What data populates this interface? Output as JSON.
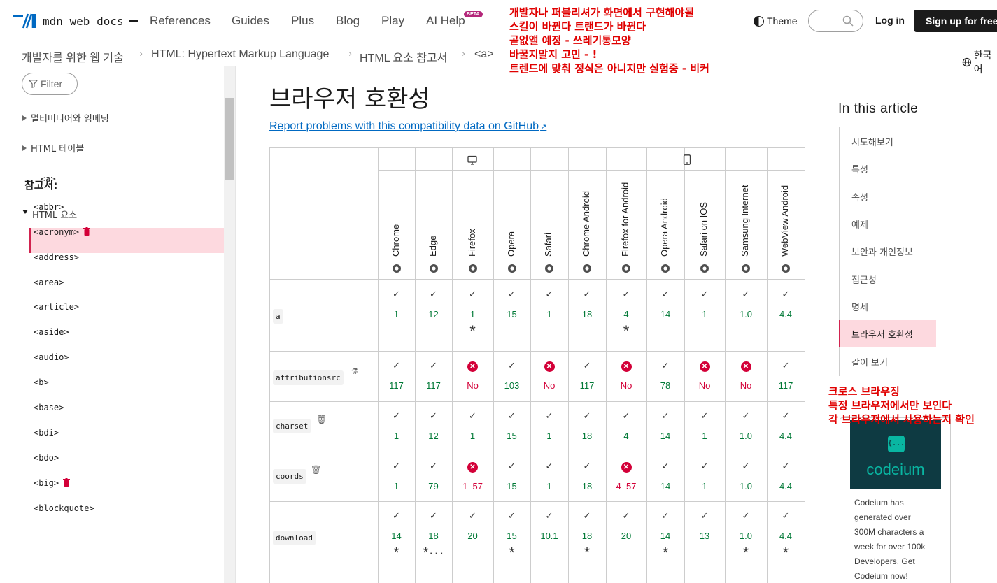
{
  "header": {
    "logo_text": "mdn web docs",
    "nav": [
      "References",
      "Guides",
      "Plus",
      "Blog",
      "Play",
      "AI Help"
    ],
    "ai_badge": "BETA",
    "theme_label": "Theme",
    "login_label": "Log in",
    "signup_label": "Sign up for free"
  },
  "breadcrumb": {
    "items": [
      "개발자를 위한 웹 기술",
      "HTML: Hypertext Markup Language",
      "HTML 요소 참고서",
      "<a>"
    ],
    "language": "한국어"
  },
  "notes": {
    "top": [
      "개발자나 퍼블리셔가 화면에서 구현해야될",
      "스킬이 바뀐다  트랜드가 바뀐다",
      "곧없앨 예정 - 쓰레기통모양",
      "바꿀지말지 고민 - !",
      "트렌드에 맞춰 정식은 아니지만 실험중 - 비커"
    ],
    "right": [
      "크로스 브라우징",
      "특정 브라우저에서만 보인다",
      "각 브라우저에서 사용하는지 확인"
    ]
  },
  "sidebar": {
    "filter_label": "Filter",
    "groups": [
      "멀티미디어와 임베딩",
      "HTML 테이블"
    ],
    "reference_heading": "참고서:",
    "open_group": "HTML 요소",
    "items": [
      {
        "label": "<a>",
        "active": true,
        "deprecated": false
      },
      {
        "label": "<abbr>",
        "active": false,
        "deprecated": false
      },
      {
        "label": "<acronym>",
        "active": false,
        "deprecated": true
      },
      {
        "label": "<address>",
        "active": false,
        "deprecated": false
      },
      {
        "label": "<area>",
        "active": false,
        "deprecated": false
      },
      {
        "label": "<article>",
        "active": false,
        "deprecated": false
      },
      {
        "label": "<aside>",
        "active": false,
        "deprecated": false
      },
      {
        "label": "<audio>",
        "active": false,
        "deprecated": false
      },
      {
        "label": "<b>",
        "active": false,
        "deprecated": false
      },
      {
        "label": "<base>",
        "active": false,
        "deprecated": false
      },
      {
        "label": "<bdi>",
        "active": false,
        "deprecated": false
      },
      {
        "label": "<bdo>",
        "active": false,
        "deprecated": false
      },
      {
        "label": "<big>",
        "active": false,
        "deprecated": true
      },
      {
        "label": "<blockquote>",
        "active": false,
        "deprecated": false
      }
    ]
  },
  "main": {
    "title": "브라우저 호환성",
    "github_link": "Report problems with this compatibility data on GitHub",
    "compat": {
      "browsers": [
        {
          "name": "Chrome",
          "icon": "chrome-icon",
          "platform": "desktop"
        },
        {
          "name": "Edge",
          "icon": "edge-icon",
          "platform": "desktop"
        },
        {
          "name": "Firefox",
          "icon": "firefox-icon",
          "platform": "desktop"
        },
        {
          "name": "Opera",
          "icon": "opera-icon",
          "platform": "desktop"
        },
        {
          "name": "Safari",
          "icon": "safari-icon",
          "platform": "desktop"
        },
        {
          "name": "Chrome Android",
          "icon": "chrome-icon",
          "platform": "mobile"
        },
        {
          "name": "Firefox for Android",
          "icon": "firefox-icon",
          "platform": "mobile"
        },
        {
          "name": "Opera Android",
          "icon": "opera-icon",
          "platform": "mobile"
        },
        {
          "name": "Safari on IOS",
          "icon": "safari-icon",
          "platform": "mobile"
        },
        {
          "name": "Samsung Internet",
          "icon": "samsung-icon",
          "platform": "mobile"
        },
        {
          "name": "WebView Android",
          "icon": "android-icon",
          "platform": "mobile"
        }
      ],
      "rows": [
        {
          "feature": "a",
          "badge": "",
          "cells": [
            {
              "s": "y",
              "v": "1",
              "note": ""
            },
            {
              "s": "y",
              "v": "12",
              "note": ""
            },
            {
              "s": "y",
              "v": "1",
              "note": "*"
            },
            {
              "s": "y",
              "v": "15",
              "note": ""
            },
            {
              "s": "y",
              "v": "1",
              "note": ""
            },
            {
              "s": "y",
              "v": "18",
              "note": ""
            },
            {
              "s": "y",
              "v": "4",
              "note": "*"
            },
            {
              "s": "y",
              "v": "14",
              "note": ""
            },
            {
              "s": "y",
              "v": "1",
              "note": ""
            },
            {
              "s": "y",
              "v": "1.0",
              "note": ""
            },
            {
              "s": "y",
              "v": "4.4",
              "note": ""
            }
          ]
        },
        {
          "feature": "attributionsrc",
          "badge": "flask",
          "cells": [
            {
              "s": "y",
              "v": "117",
              "note": ""
            },
            {
              "s": "y",
              "v": "117",
              "note": ""
            },
            {
              "s": "n",
              "v": "No",
              "note": ""
            },
            {
              "s": "y",
              "v": "103",
              "note": ""
            },
            {
              "s": "n",
              "v": "No",
              "note": ""
            },
            {
              "s": "y",
              "v": "117",
              "note": ""
            },
            {
              "s": "n",
              "v": "No",
              "note": ""
            },
            {
              "s": "y",
              "v": "78",
              "note": ""
            },
            {
              "s": "n",
              "v": "No",
              "note": ""
            },
            {
              "s": "n",
              "v": "No",
              "note": ""
            },
            {
              "s": "y",
              "v": "117",
              "note": ""
            }
          ]
        },
        {
          "feature": "charset",
          "badge": "trash",
          "cells": [
            {
              "s": "y",
              "v": "1",
              "note": ""
            },
            {
              "s": "y",
              "v": "12",
              "note": ""
            },
            {
              "s": "y",
              "v": "1",
              "note": ""
            },
            {
              "s": "y",
              "v": "15",
              "note": ""
            },
            {
              "s": "y",
              "v": "1",
              "note": ""
            },
            {
              "s": "y",
              "v": "18",
              "note": ""
            },
            {
              "s": "y",
              "v": "4",
              "note": ""
            },
            {
              "s": "y",
              "v": "14",
              "note": ""
            },
            {
              "s": "y",
              "v": "1",
              "note": ""
            },
            {
              "s": "y",
              "v": "1.0",
              "note": ""
            },
            {
              "s": "y",
              "v": "4.4",
              "note": ""
            }
          ]
        },
        {
          "feature": "coords",
          "badge": "trash",
          "cells": [
            {
              "s": "y",
              "v": "1",
              "note": ""
            },
            {
              "s": "y",
              "v": "79",
              "note": ""
            },
            {
              "s": "n",
              "v": "1–57",
              "note": ""
            },
            {
              "s": "y",
              "v": "15",
              "note": ""
            },
            {
              "s": "y",
              "v": "1",
              "note": ""
            },
            {
              "s": "y",
              "v": "18",
              "note": ""
            },
            {
              "s": "n",
              "v": "4–57",
              "note": ""
            },
            {
              "s": "y",
              "v": "14",
              "note": ""
            },
            {
              "s": "y",
              "v": "1",
              "note": ""
            },
            {
              "s": "y",
              "v": "1.0",
              "note": ""
            },
            {
              "s": "y",
              "v": "4.4",
              "note": ""
            }
          ]
        },
        {
          "feature": "download",
          "badge": "",
          "cells": [
            {
              "s": "y",
              "v": "14",
              "note": "*"
            },
            {
              "s": "y",
              "v": "18",
              "note": "*···"
            },
            {
              "s": "y",
              "v": "20",
              "note": ""
            },
            {
              "s": "y",
              "v": "15",
              "note": "*"
            },
            {
              "s": "y",
              "v": "10.1",
              "note": ""
            },
            {
              "s": "y",
              "v": "18",
              "note": "*"
            },
            {
              "s": "y",
              "v": "20",
              "note": ""
            },
            {
              "s": "y",
              "v": "14",
              "note": "*"
            },
            {
              "s": "y",
              "v": "13",
              "note": ""
            },
            {
              "s": "y",
              "v": "1.0",
              "note": "*"
            },
            {
              "s": "y",
              "v": "4.4",
              "note": "*"
            }
          ]
        }
      ]
    }
  },
  "toc": {
    "title": "In this article",
    "items": [
      "시도해보기",
      "특성",
      "속성",
      "예제",
      "보안과 개인정보",
      "접근성",
      "명세",
      "브라우저 호환성",
      "같이 보기"
    ],
    "active": "브라우저 호환성"
  },
  "ad": {
    "logo_glyph": "{...}",
    "brand": "codeium",
    "copy": [
      "Codeium has",
      "generated over",
      "300M characters a",
      "week for over 100k",
      "Developers. Get",
      "Codeium now!"
    ]
  }
}
